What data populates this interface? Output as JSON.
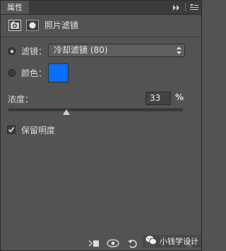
{
  "panel": {
    "tab_label": "属性",
    "title": "照片滤镜"
  },
  "filter": {
    "radio_label": "滤镜：",
    "selected": true,
    "value": "冷却滤镜 (80)"
  },
  "color": {
    "radio_label": "颜色：",
    "selected": false,
    "swatch": "#0a6ffd"
  },
  "density": {
    "label": "浓度：",
    "value": "33",
    "unit": "%",
    "level_percent": 33
  },
  "preserve_luminosity": {
    "label": "保留明度",
    "checked": true
  },
  "watermark": {
    "text": "小钱学设计"
  },
  "footer_icons": [
    "clip-to-layer-icon",
    "view-previous-state-icon",
    "reset-icon",
    "visibility-icon",
    "delete-icon"
  ]
}
